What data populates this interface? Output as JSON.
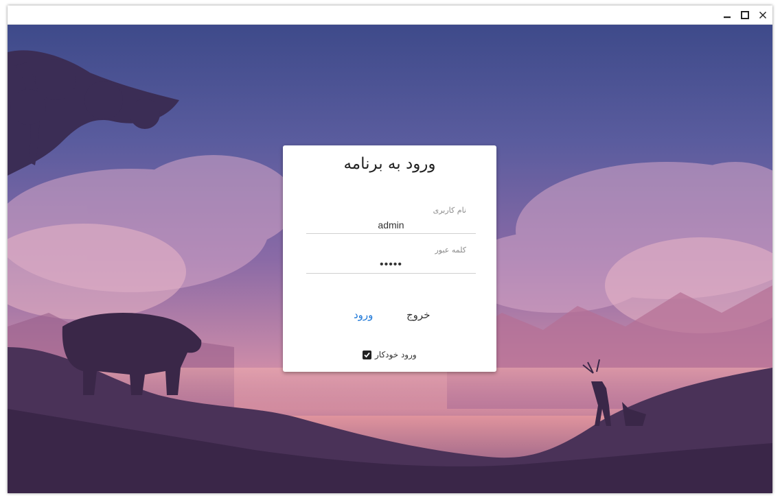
{
  "window": {
    "controls": [
      {
        "name": "minimize-icon"
      },
      {
        "name": "maximize-icon"
      },
      {
        "name": "close-icon"
      }
    ]
  },
  "login": {
    "title": "ورود به برنامه",
    "username_label": "نام کاربری",
    "username_value": "admin",
    "password_label": "کلمه عبور",
    "password_value": "•••••",
    "exit_label": "خروج",
    "login_label": "ورود",
    "autologin_label": "ورود خودکار",
    "autologin_checked": true
  },
  "colors": {
    "accent": "#1e78d8",
    "text": "#222222"
  }
}
